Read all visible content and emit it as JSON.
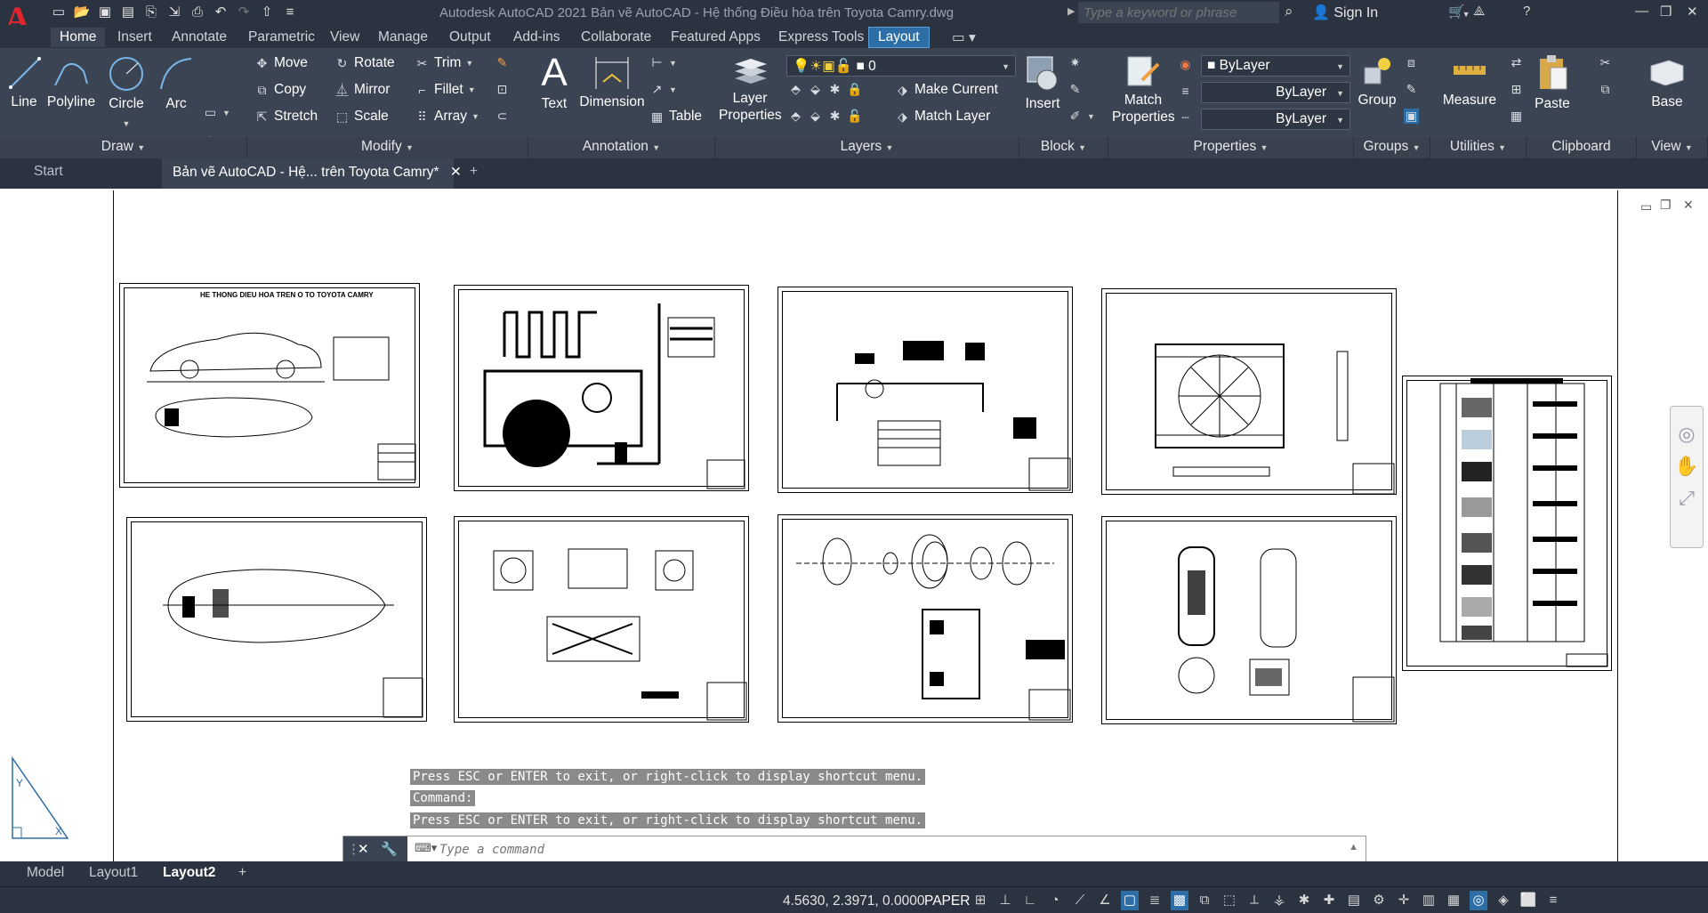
{
  "titlebar": {
    "app_title": "Autodesk AutoCAD 2021    Bản vẽ AutoCAD - Hệ thống Điều hòa trên Toyota Camry.dwg",
    "search_placeholder": "Type a keyword or phrase",
    "sign_in": "Sign In"
  },
  "ribbon_tabs": [
    "Home",
    "Insert",
    "Annotate",
    "Parametric",
    "View",
    "Manage",
    "Output",
    "Add-ins",
    "Collaborate",
    "Featured Apps",
    "Express Tools",
    "Layout"
  ],
  "draw": {
    "title": "Draw",
    "line": "Line",
    "polyline": "Polyline",
    "circle": "Circle",
    "arc": "Arc"
  },
  "modify": {
    "title": "Modify",
    "move": "Move",
    "rotate": "Rotate",
    "trim": "Trim",
    "copy": "Copy",
    "mirror": "Mirror",
    "fillet": "Fillet",
    "stretch": "Stretch",
    "scale": "Scale",
    "array": "Array"
  },
  "annotation": {
    "title": "Annotation",
    "text": "Text",
    "dimension": "Dimension",
    "table": "Table"
  },
  "layers": {
    "title": "Layers",
    "layer_properties": "Layer Properties",
    "current_layer": "0",
    "make_current": "Make Current",
    "match_layer": "Match Layer"
  },
  "block": {
    "title": "Block",
    "insert": "Insert"
  },
  "properties": {
    "title": "Properties",
    "match_properties": "Match Properties",
    "color": "ByLayer",
    "linetype": "ByLayer",
    "lineweight": "ByLayer"
  },
  "groups": {
    "title": "Groups",
    "group": "Group"
  },
  "utilities": {
    "title": "Utilities",
    "measure": "Measure"
  },
  "clipboard": {
    "title": "Clipboard",
    "paste": "Paste"
  },
  "view": {
    "title": "View",
    "base": "Base"
  },
  "doc_tabs": {
    "start": "Start",
    "drawing": "Bản vẽ AutoCAD - Hệ... trên Toyota Camry*"
  },
  "sheet1_title": "HE THONG DIEU HOA TREN O TO TOYOTA CAMRY",
  "command": {
    "msg1": "Press ESC or ENTER to exit, or right-click to display shortcut menu.",
    "msg2": "Command:",
    "msg3": "Press ESC or ENTER to exit, or right-click to display shortcut menu.",
    "placeholder": "Type a command"
  },
  "layout_tabs": [
    "Model",
    "Layout1",
    "Layout2"
  ],
  "status": {
    "coords": "4.5630, 2.3971, 0.0000",
    "space": "PAPER"
  },
  "colors": {
    "accent": "#2d6ea6",
    "ribbon": "#3b4453",
    "titlebar": "#2b3240"
  }
}
